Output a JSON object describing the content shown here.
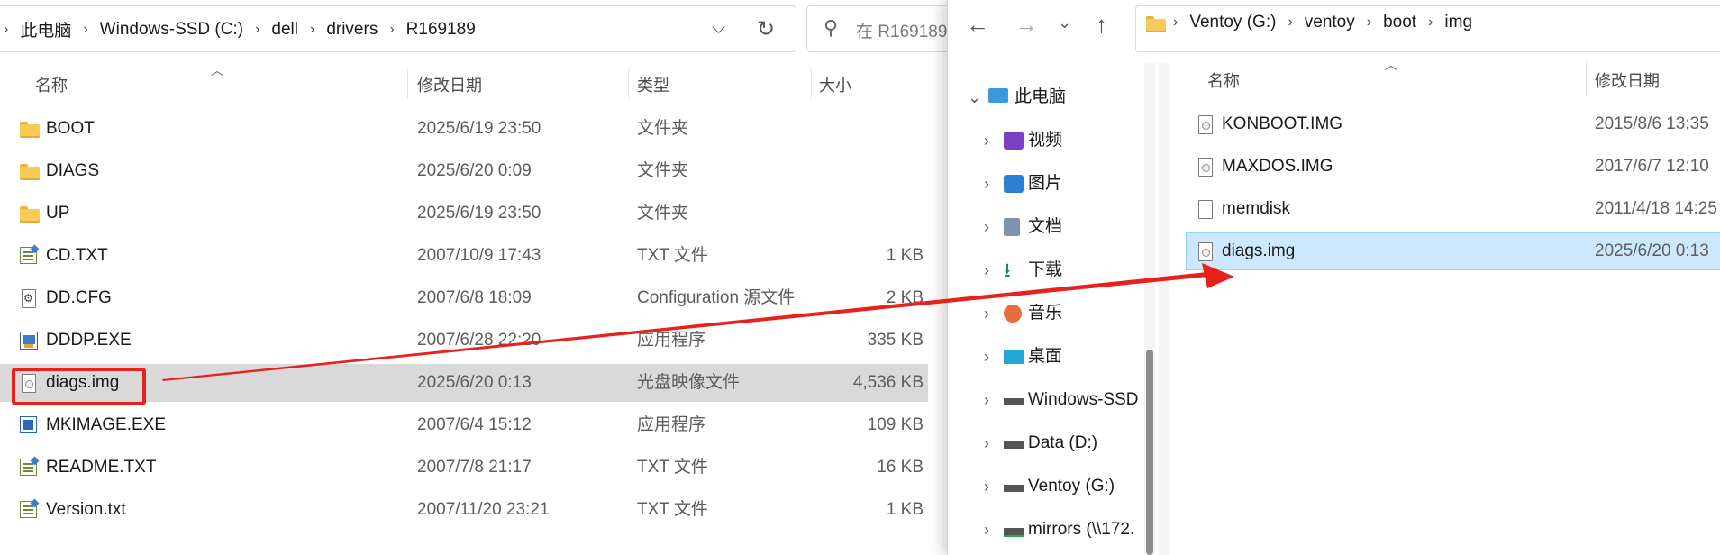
{
  "left": {
    "breadcrumb": [
      "此电脑",
      "Windows-SSD (C:)",
      "dell",
      "drivers",
      "R169189"
    ],
    "search_placeholder": "在 R169189",
    "columns": {
      "name": "名称",
      "date": "修改日期",
      "type": "类型",
      "size": "大小"
    },
    "files": [
      {
        "name": "BOOT",
        "date": "2025/6/19 23:50",
        "type": "文件夹",
        "size": "",
        "icon": "folder-icon"
      },
      {
        "name": "DIAGS",
        "date": "2025/6/20 0:09",
        "type": "文件夹",
        "size": "",
        "icon": "folder-icon"
      },
      {
        "name": "UP",
        "date": "2025/6/19 23:50",
        "type": "文件夹",
        "size": "",
        "icon": "folder-icon"
      },
      {
        "name": "CD.TXT",
        "date": "2007/10/9 17:43",
        "type": "TXT 文件",
        "size": "1 KB",
        "icon": "txt-file-icon"
      },
      {
        "name": "DD.CFG",
        "date": "2007/6/8 18:09",
        "type": "Configuration 源文件",
        "size": "2 KB",
        "icon": "config-file-icon"
      },
      {
        "name": "DDDP.EXE",
        "date": "2007/6/28 22:20",
        "type": "应用程序",
        "size": "335 KB",
        "icon": "exe-icon"
      },
      {
        "name": "diags.img",
        "date": "2025/6/20 0:13",
        "type": "光盘映像文件",
        "size": "4,536 KB",
        "icon": "disc-image-icon",
        "selected": true
      },
      {
        "name": "MKIMAGE.EXE",
        "date": "2007/6/4 15:12",
        "type": "应用程序",
        "size": "109 KB",
        "icon": "app-icon"
      },
      {
        "name": "README.TXT",
        "date": "2007/7/8 21:17",
        "type": "TXT 文件",
        "size": "16 KB",
        "icon": "txt-file-icon"
      },
      {
        "name": "Version.txt",
        "date": "2007/11/20 23:21",
        "type": "TXT 文件",
        "size": "1 KB",
        "icon": "txt-file-icon"
      }
    ]
  },
  "right": {
    "breadcrumb": [
      "Ventoy (G:)",
      "ventoy",
      "boot",
      "img"
    ],
    "tree": {
      "root": "此电脑",
      "items": [
        {
          "label": "视频",
          "icon": "video-icon"
        },
        {
          "label": "图片",
          "icon": "pictures-icon"
        },
        {
          "label": "文档",
          "icon": "documents-icon"
        },
        {
          "label": "下载",
          "icon": "download-icon"
        },
        {
          "label": "音乐",
          "icon": "music-icon"
        },
        {
          "label": "桌面",
          "icon": "desktop-icon"
        },
        {
          "label": "Windows-SSD",
          "icon": "windows-drive-icon"
        },
        {
          "label": "Data (D:)",
          "icon": "drive-icon"
        },
        {
          "label": "Ventoy (G:)",
          "icon": "drive-icon"
        },
        {
          "label": "mirrors (\\\\172.",
          "icon": "network-drive-icon"
        }
      ]
    },
    "columns": {
      "name": "名称",
      "date": "修改日期"
    },
    "files": [
      {
        "name": "KONBOOT.IMG",
        "date": "2015/8/6 13:35"
      },
      {
        "name": "MAXDOS.IMG",
        "date": "2017/6/7 12:10"
      },
      {
        "name": "memdisk",
        "date": "2011/4/18 14:25"
      },
      {
        "name": "diags.img",
        "date": "2025/6/20 0:13",
        "selected": true
      }
    ]
  },
  "colors": {
    "annotation": "#e9211c",
    "selection_gray": "#d9d9d9",
    "selection_blue": "#cce8ff"
  }
}
